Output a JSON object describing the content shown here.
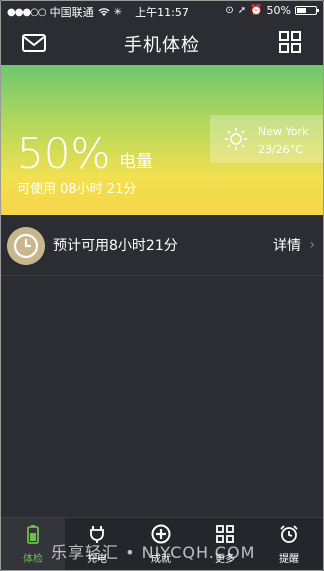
{
  "status": {
    "carrier": "中国联通",
    "time": "上午11:57",
    "battery_text": "50%",
    "battery_level": 0.5
  },
  "header": {
    "title": "手机体检",
    "left_icon": "mail-icon",
    "right_icon": "grid-icon"
  },
  "battery": {
    "percent": "50%",
    "label": "电量",
    "remaining": "可使用 08小时 21分"
  },
  "weather": {
    "city": "New York",
    "temp": "23/26°C",
    "icon": "sun-icon"
  },
  "estimate": {
    "text": "预计可用8小时21分",
    "detail": "详情",
    "icon": "clock-icon"
  },
  "tabs": [
    {
      "label": "体检",
      "icon": "battery-icon"
    },
    {
      "label": "充电",
      "icon": "plug-icon"
    },
    {
      "label": "成就",
      "icon": "plus-circle-icon"
    },
    {
      "label": "更多",
      "icon": "grid-icon"
    },
    {
      "label": "提醒",
      "icon": "alarm-icon"
    }
  ],
  "watermark": "乐享轻汇 • NIYCQH.COM",
  "colors": {
    "accent_green": "#6fbf4f",
    "background": "#2b2d33",
    "banner_top": "#6fc66f",
    "banner_bottom": "#f5d44a"
  }
}
